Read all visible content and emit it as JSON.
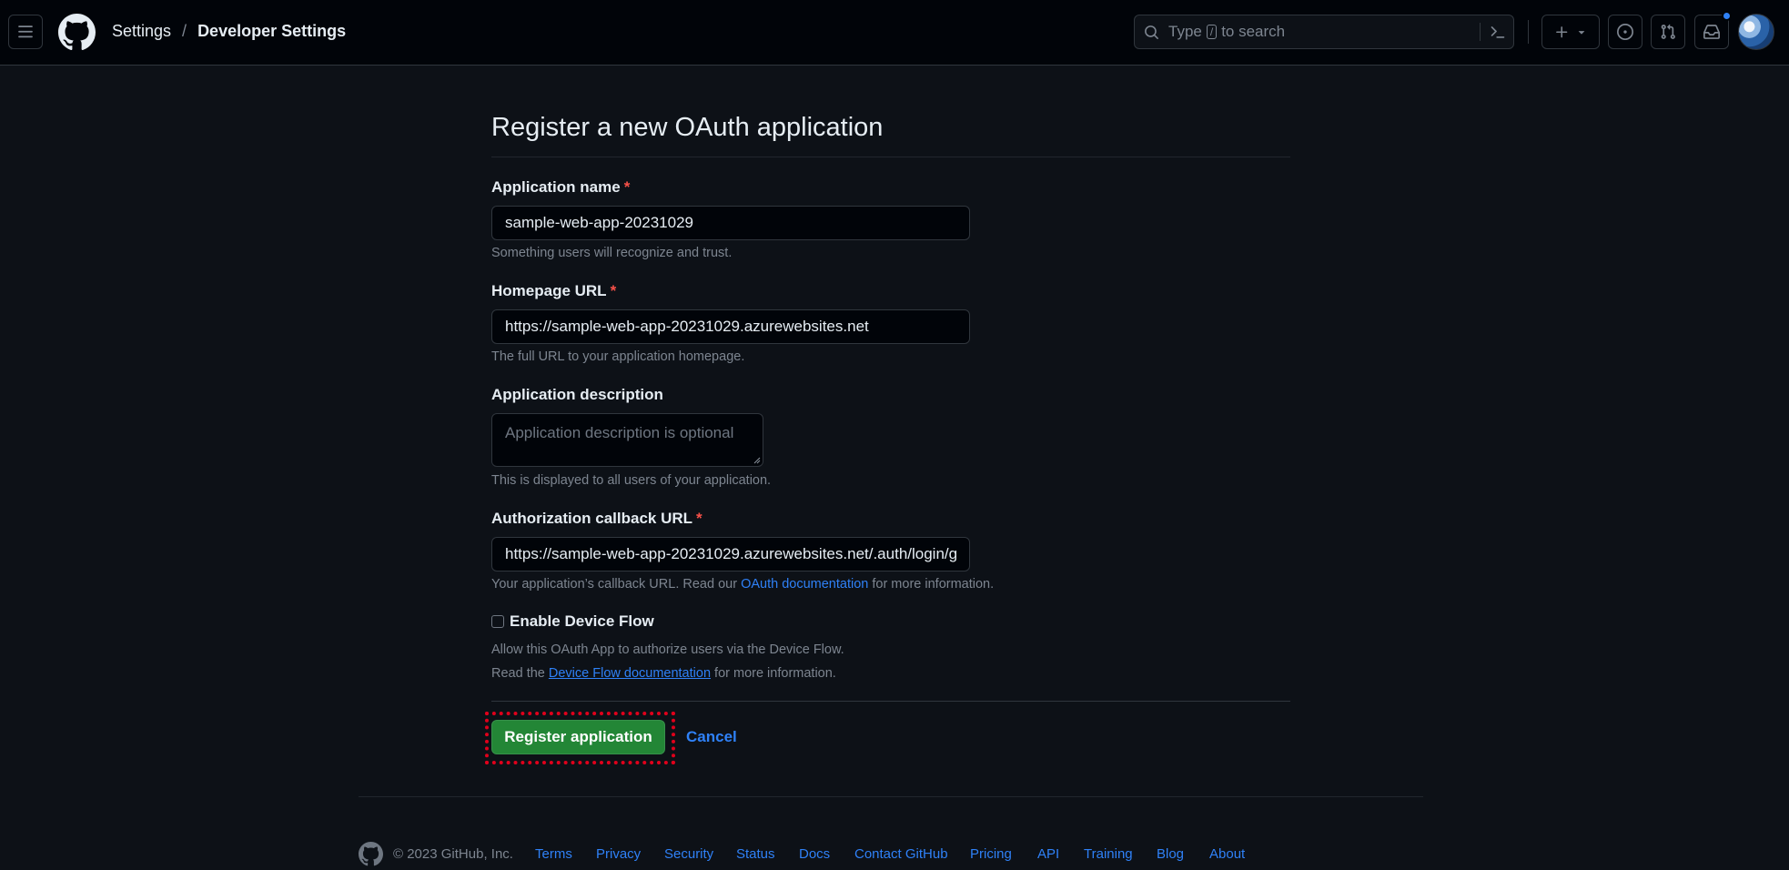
{
  "header": {
    "breadcrumbs": [
      "Settings",
      "Developer Settings"
    ],
    "separator": "/",
    "search": {
      "prefix": "Type",
      "key": "/",
      "suffix": "to search"
    },
    "icons": [
      "menu-icon",
      "github-logo-icon",
      "search-icon",
      "command-palette-icon",
      "plus-icon",
      "triangle-down-icon",
      "issue-opened-icon",
      "git-pull-request-icon",
      "inbox-icon"
    ],
    "notification_dot_color": "#2f81f7"
  },
  "form": {
    "title": "Register a new OAuth application",
    "required_marker": "*",
    "app_name": {
      "label": "Application name",
      "value": "sample-web-app-20231029",
      "note": "Something users will recognize and trust."
    },
    "homepage_url": {
      "label": "Homepage URL",
      "value": "https://sample-web-app-20231029.azurewebsites.net",
      "note": "The full URL to your application homepage."
    },
    "description": {
      "label": "Application description",
      "placeholder": "Application description is optional",
      "note": "This is displayed to all users of your application."
    },
    "callback_url": {
      "label": "Authorization callback URL",
      "value": "https://sample-web-app-20231029.azurewebsites.net/.auth/login/g",
      "note_prefix": "Your application’s callback URL. Read our",
      "note_link": "OAuth documentation",
      "note_suffix": "for more information."
    },
    "device_flow": {
      "label": "Enable Device Flow",
      "checked": false,
      "note1": "Allow this OAuth App to authorize users via the Device Flow.",
      "note2_prefix": "Read the",
      "note2_link": "Device Flow documentation",
      "note2_suffix": "for more information."
    },
    "submit_label": "Register application",
    "cancel_label": "Cancel"
  },
  "footer": {
    "copyright": "© 2023 GitHub, Inc.",
    "links": [
      "Terms",
      "Privacy",
      "Security",
      "Status",
      "Docs",
      "Contact GitHub",
      "Pricing",
      "API",
      "Training",
      "Blog",
      "About"
    ]
  },
  "colors": {
    "background": "#0d1117",
    "header_bg": "#010409",
    "primary_button": "#238636",
    "link": "#2f81f7",
    "required": "#f85149",
    "highlight_outline": "#e0001b"
  }
}
